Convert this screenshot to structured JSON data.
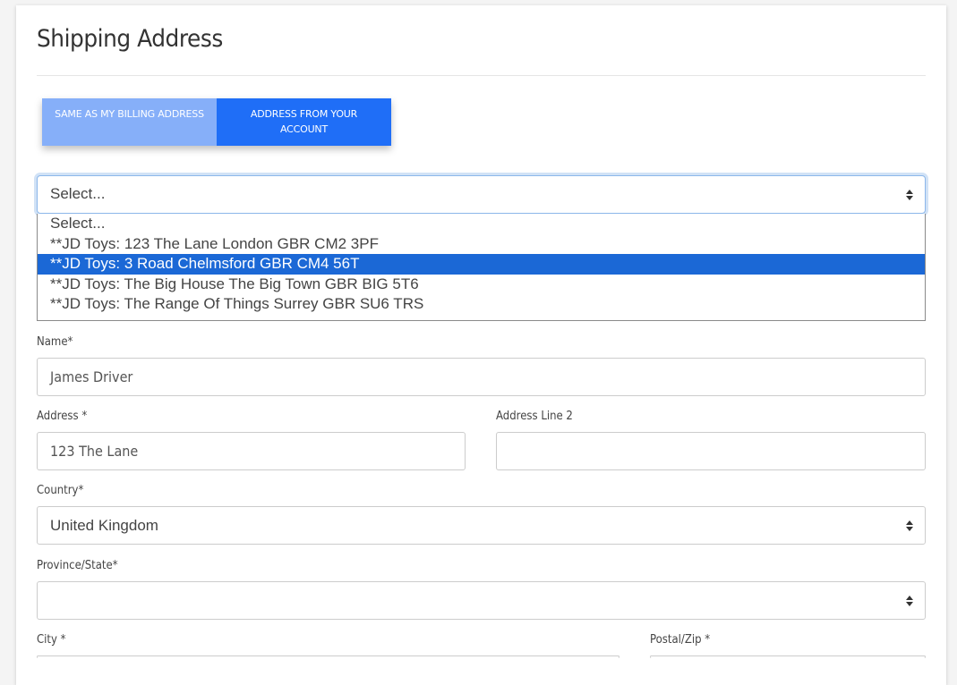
{
  "section": {
    "title": "Shipping Address"
  },
  "toggle": {
    "same_as_billing": "SAME AS MY BILLING ADDRESS",
    "from_account": "ADDRESS FROM YOUR ACCOUNT",
    "active": "from_account"
  },
  "address_select": {
    "value": "Select...",
    "options": [
      "Select...",
      "**JD Toys: 123 The Lane London GBR CM2 3PF",
      "**JD Toys: 3 Road Chelmsford GBR CM4 56T",
      "**JD Toys: The Big House The Big Town GBR BIG 5T6",
      "**JD Toys: The Range Of Things Surrey GBR SU6 TRS"
    ],
    "highlighted_index": 2
  },
  "form": {
    "name_label": "Name*",
    "name_value": "James Driver",
    "address_label": "Address *",
    "address_value": "123 The Lane",
    "address2_label": "Address Line 2",
    "address2_value": "",
    "country_label": "Country*",
    "country_value": "United Kingdom",
    "province_label": "Province/State*",
    "province_value": "",
    "city_label": "City *",
    "postal_label": "Postal/Zip *"
  }
}
